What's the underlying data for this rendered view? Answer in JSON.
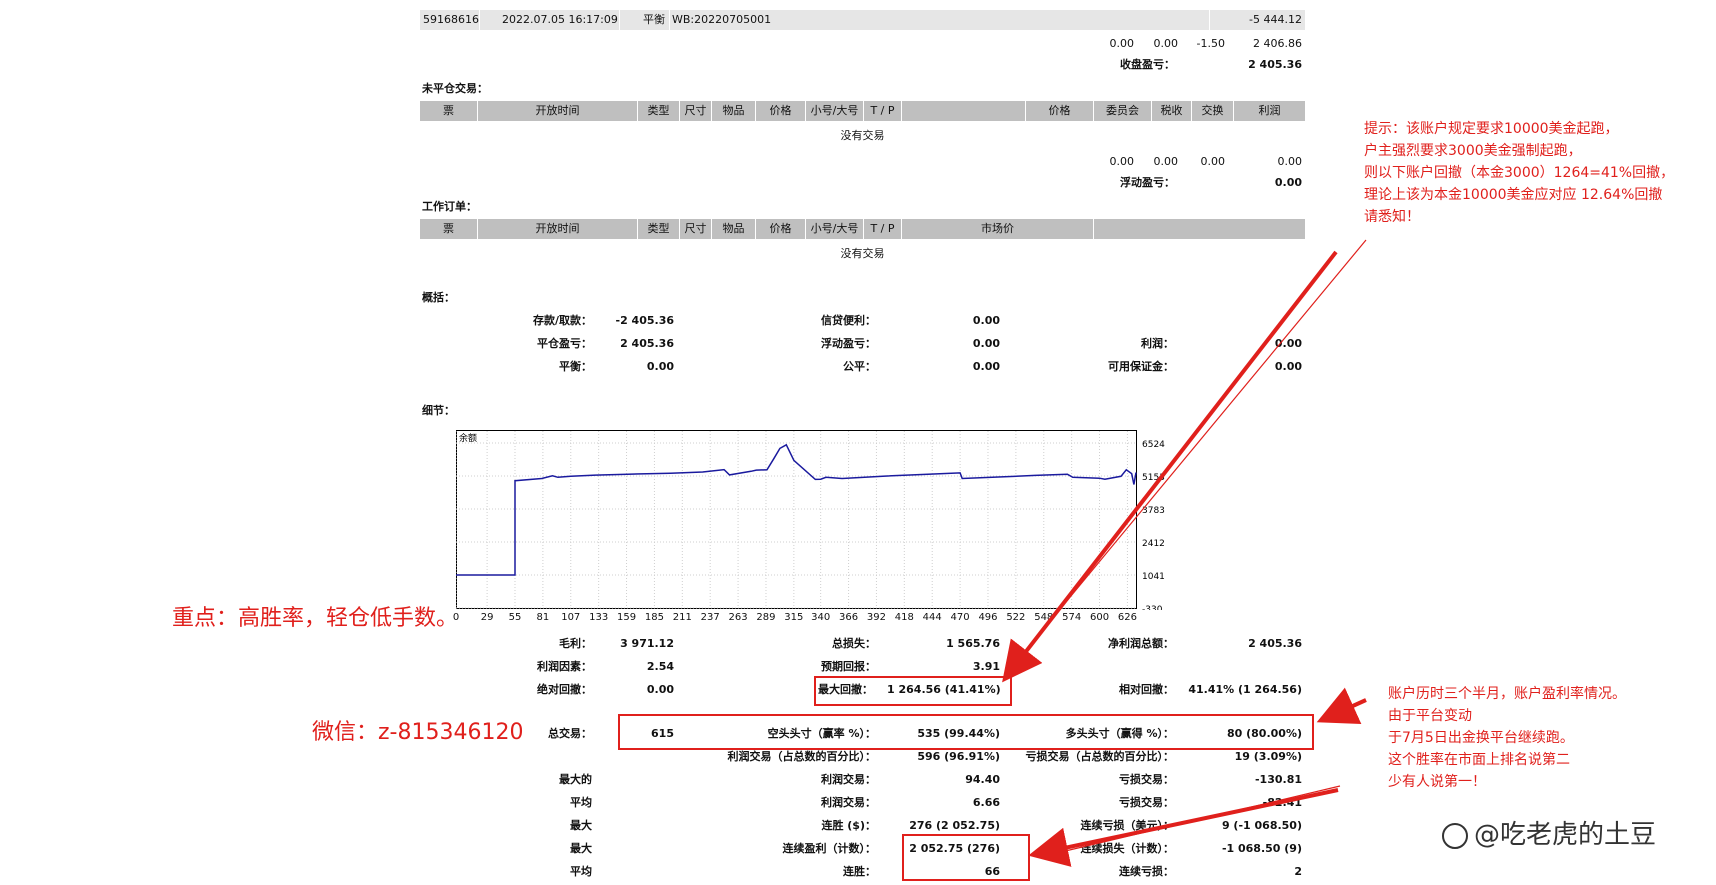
{
  "top_row": {
    "ticket": "59168616",
    "time": "2022.07.05 16:17:09",
    "type": "平衡",
    "comment": "WB:20220705001",
    "amount": "-5 444.12"
  },
  "totals1": {
    "v1": "0.00",
    "v2": "0.00",
    "v3": "-1.50",
    "v4": "2 406.86",
    "label": "收盘盈亏：",
    "value": "2 405.36"
  },
  "open_trades": {
    "title": "未平仓交易：",
    "headers": [
      "票",
      "开放时间",
      "类型",
      "尺寸",
      "物品",
      "价格",
      "小号/大号",
      "T / P",
      "",
      "价格",
      "委员会",
      "税收",
      "交换",
      "利润"
    ],
    "empty": "没有交易",
    "totals": {
      "v1": "0.00",
      "v2": "0.00",
      "v3": "0.00",
      "v4": "0.00"
    },
    "float_label": "浮动盈亏：",
    "float_value": "0.00"
  },
  "work_orders": {
    "title": "工作订单：",
    "headers": [
      "票",
      "开放时间",
      "类型",
      "尺寸",
      "物品",
      "价格",
      "小号/大号",
      "T / P",
      "市场价",
      ""
    ],
    "empty": "没有交易"
  },
  "summary": {
    "title": "概括：",
    "deposit_label": "存款/取款：",
    "deposit": "-2 405.36",
    "credit_label": "信贷便利：",
    "credit": "0.00",
    "closed_pl_label": "平仓盈亏：",
    "closed_pl": "2 405.36",
    "float_pl_label": "浮动盈亏：",
    "float_pl": "0.00",
    "profit_label": "利润：",
    "profit": "0.00",
    "balance_label": "平衡：",
    "balance": "0.00",
    "equity_label": "公平：",
    "equity": "0.00",
    "free_margin_label": "可用保证金：",
    "free_margin": "0.00"
  },
  "details_title": "细节：",
  "chart_data": {
    "type": "line",
    "title": "余额",
    "xlabel": "",
    "ylabel": "",
    "x_ticks": [
      0,
      29,
      55,
      81,
      107,
      133,
      159,
      185,
      211,
      237,
      263,
      289,
      315,
      340,
      366,
      392,
      418,
      444,
      470,
      496,
      522,
      548,
      574,
      600,
      626
    ],
    "y_ticks": [
      6524,
      5153,
      3783,
      2412,
      1041,
      -330
    ],
    "ylim": [
      -330,
      6524
    ],
    "xlim": [
      0,
      634
    ],
    "series": [
      {
        "x": [
          0,
          55,
          55,
          80,
          90,
          95,
          107,
          130,
          160,
          200,
          230,
          250,
          255,
          275,
          280,
          290,
          296,
          302,
          308,
          315,
          335,
          340,
          345,
          360,
          400,
          440,
          470,
          472,
          500,
          540,
          570,
          575,
          600,
          605,
          620,
          625,
          630,
          632,
          634
        ],
        "y": [
          1041,
          1041,
          4960,
          5050,
          5160,
          5100,
          5140,
          5190,
          5230,
          5270,
          5320,
          5420,
          5200,
          5350,
          5400,
          5410,
          5850,
          6300,
          6450,
          5800,
          5010,
          5020,
          5100,
          5050,
          5150,
          5230,
          5280,
          5050,
          5100,
          5180,
          5230,
          5100,
          5060,
          5020,
          5140,
          5410,
          5250,
          4800,
          5300
        ]
      }
    ],
    "grid": true,
    "line_color": "#1a1a9e"
  },
  "stats": {
    "gross_profit_label": "毛利：",
    "gross_profit": "3 971.12",
    "gross_loss_label": "总损失：",
    "gross_loss": "1 565.76",
    "net_profit_label": "净利润总额：",
    "net_profit": "2 405.36",
    "profit_factor_label": "利润因素：",
    "profit_factor": "2.54",
    "expected_label": "预期回报：",
    "expected": "3.91",
    "abs_dd_label": "绝对回撤：",
    "abs_dd": "0.00",
    "max_dd_label": "最大回撤：",
    "max_dd": "1 264.56 (41.41%)",
    "rel_dd_label": "相对回撤：",
    "rel_dd": "41.41% (1 264.56)",
    "total_trades_label": "总交易：",
    "total_trades": "615",
    "short_label": "空头头寸（赢率 %）：",
    "short": "535 (99.44%)",
    "long_label": "多头头寸（赢得 %）：",
    "long": "80 (80.00%)",
    "profit_trades_label": "利润交易（占总数的百分比）：",
    "profit_trades": "596 (96.91%)",
    "loss_trades_label": "亏损交易（占总数的百分比）：",
    "loss_trades": "19 (3.09%)",
    "largest_label": "最大的",
    "largest_profit_label": "利润交易：",
    "largest_profit": "94.40",
    "largest_loss_label": "亏损交易：",
    "largest_loss": "-130.81",
    "average_label": "平均",
    "avg_profit_label": "利润交易：",
    "avg_profit": "6.66",
    "avg_loss_label": "亏损交易：",
    "avg_loss": "-82.41",
    "max1_label": "最大",
    "max_cons_win_label": "连胜 ($)：",
    "max_cons_win": "276 (2 052.75)",
    "max_cons_loss_label": "连续亏损（美元）：",
    "max_cons_loss": "9 (-1 068.50)",
    "max2_label": "最大",
    "max_cons_profit_label": "连续盈利（计数）：",
    "max_cons_profit": "2 052.75 (276)",
    "max_cons_loss_cnt_label": "连续损失（计数）：",
    "max_cons_loss_cnt": "-1 068.50 (9)",
    "avg2_label": "平均",
    "avg_cons_win_label": "连胜：",
    "avg_cons_win": "66",
    "avg_cons_loss_label": "连续亏损：",
    "avg_cons_loss": "2"
  },
  "annotations": {
    "note1": [
      "提示：该账户规定要求10000美金起跑，",
      "户主强烈要求3000美金强制起跑，",
      "则以下账户回撤（本金3000）1264=41%回撤，",
      "理论上该为本金10000美金应对应 12.64%回撤",
      "请悉知！"
    ],
    "key_point": "重点：高胜率，轻仓低手数。",
    "wechat": "微信：z-815346120",
    "note2": [
      "账户历时三个半月，账户盈利率情况。",
      "由于平台变动",
      "于7月5日出金换平台继续跑。",
      "这个胜率在市面上排名说第二",
      "少有人说第一！"
    ],
    "watermark": "@吃老虎的土豆"
  },
  "colors": {
    "red": "#e0201c",
    "header_gray": "#bfbfbf",
    "row_gray": "#e6e6e6",
    "line": "#1a1a9e"
  }
}
